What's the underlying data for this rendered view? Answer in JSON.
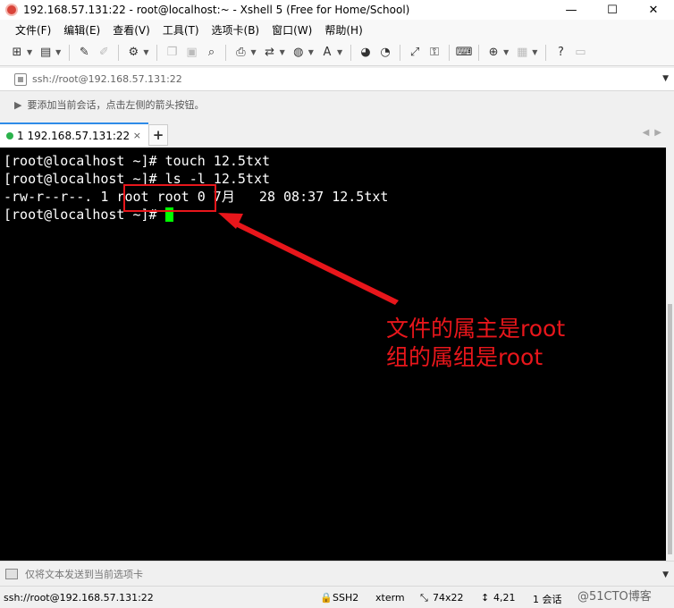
{
  "window": {
    "title": "192.168.57.131:22 - root@localhost:~ - Xshell 5 (Free for Home/School)",
    "controls": {
      "minimize": "—",
      "maximize": "☐",
      "close": "✕"
    }
  },
  "menu": [
    "文件(F)",
    "编辑(E)",
    "查看(V)",
    "工具(T)",
    "选项卡(B)",
    "窗口(W)",
    "帮助(H)"
  ],
  "address": {
    "value": "ssh://root@192.168.57.131:22"
  },
  "hint": {
    "text": "要添加当前会话，点击左侧的箭头按钮。"
  },
  "tabs": [
    {
      "label": "1 192.168.57.131:22",
      "close": "×"
    }
  ],
  "tab_add": "+",
  "terminal": {
    "lines": [
      "[root@localhost ~]# touch 12.5txt",
      "[root@localhost ~]# ls -l 12.5txt",
      "-rw-r--r--. 1 root root 0 7月   28 08:37 12.5txt",
      "[root@localhost ~]# "
    ]
  },
  "annotation": {
    "line1": "文件的属主是root",
    "line2": "组的属组是root",
    "color": "#e8161b"
  },
  "sendbar": {
    "text": "仅将文本发送到当前选项卡"
  },
  "status": {
    "connection": "ssh://root@192.168.57.131:22",
    "protocol": "SSH2",
    "term": "xterm",
    "size": "74x22",
    "position": "4,21",
    "sessions": "1 会话"
  },
  "watermark": "@51CTO博客"
}
